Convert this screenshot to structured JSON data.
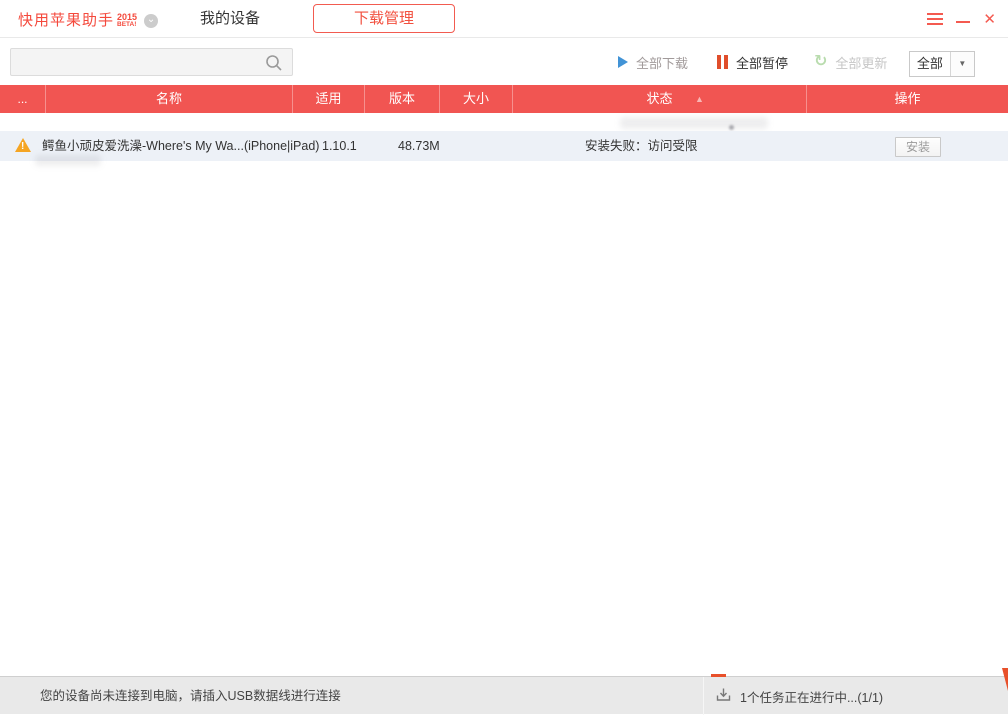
{
  "app": {
    "logo_title": "快用苹果助手",
    "logo_year": "2015",
    "logo_beta": "BETA!",
    "tab_devices": "我的设备",
    "tab_downloads": "下载管理"
  },
  "search": {
    "value": "",
    "placeholder": ""
  },
  "toolbar": {
    "download_all": "全部下载",
    "pause_all": "全部暂停",
    "update_all": "全部更新",
    "filter_value": "全部"
  },
  "table": {
    "columns": {
      "more": "...",
      "name": "名称",
      "platform": "适用",
      "version": "版本",
      "size": "大小",
      "status": "状态",
      "action": "操作"
    },
    "rows": [
      {
        "name": "鳄鱼小顽皮爱洗澡-Where's My Wa...",
        "platform": "(iPhone|iPad)",
        "version": "1.10.1",
        "size": "48.73M",
        "status": "安装失败：访问受限",
        "action_label": "安装"
      }
    ]
  },
  "statusbar": {
    "device_message": "您的设备尚未连接到电脑，请插入USB数据线进行连接",
    "task_message": "1个任务正在进行中...(1/1)"
  },
  "icons": {
    "logo_chevron": "⌄",
    "close": "✕",
    "update": "↻",
    "filter_caret": "▼",
    "sort_asc": "▲",
    "warning_mark": "!"
  },
  "colors": {
    "accent_red": "#f4493c",
    "header_red": "#f15552",
    "warning_orange": "#f5a523",
    "play_blue": "#4193d6",
    "pause_orange": "#e04e2b",
    "update_green": "#b9dcae",
    "row_bg": "#edf1f7",
    "statusbar_bg": "#e9e9e9",
    "progress_red": "#e8502a"
  }
}
